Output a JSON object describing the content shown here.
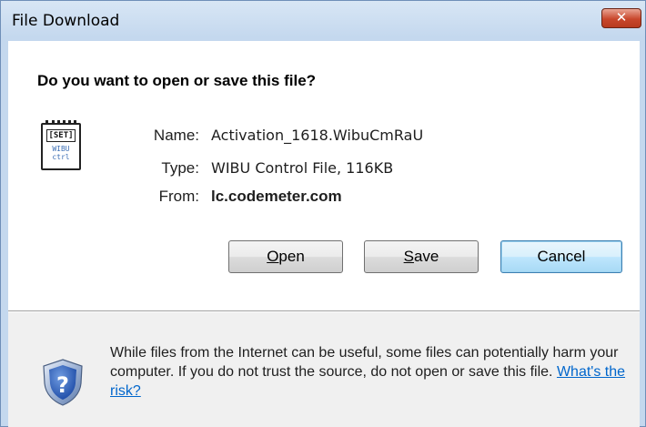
{
  "window": {
    "title": "File Download",
    "close_glyph": "✕"
  },
  "dialog": {
    "question": "Do you want to open or save this file?",
    "file_icon": {
      "name": "wibu-file-icon",
      "top_text": "[SET]",
      "line1": "WIBU",
      "line2": "ctrl"
    },
    "fields": {
      "name_label": "Name:",
      "name_value": "Activation_1618.WibuCmRaU",
      "type_label": "Type:",
      "type_value": "WIBU Control File, 116KB",
      "from_label": "From:",
      "from_value": "lc.codemeter.com"
    },
    "buttons": {
      "open_label": "Open",
      "open_accesskey": "O",
      "save_label": "Save",
      "save_accesskey": "S",
      "cancel_label": "Cancel"
    }
  },
  "warning": {
    "icon": "security-shield-question-icon",
    "text": "While files from the Internet can be useful, some files can potentially harm your computer. If you do not trust the source, do not open or save this file.",
    "link": "What's the risk?"
  },
  "colors": {
    "link": "#0066cc",
    "close_button": "#c8472c",
    "default_button_border": "#3c7fb1",
    "lower_panel": "#f0f0f0"
  }
}
